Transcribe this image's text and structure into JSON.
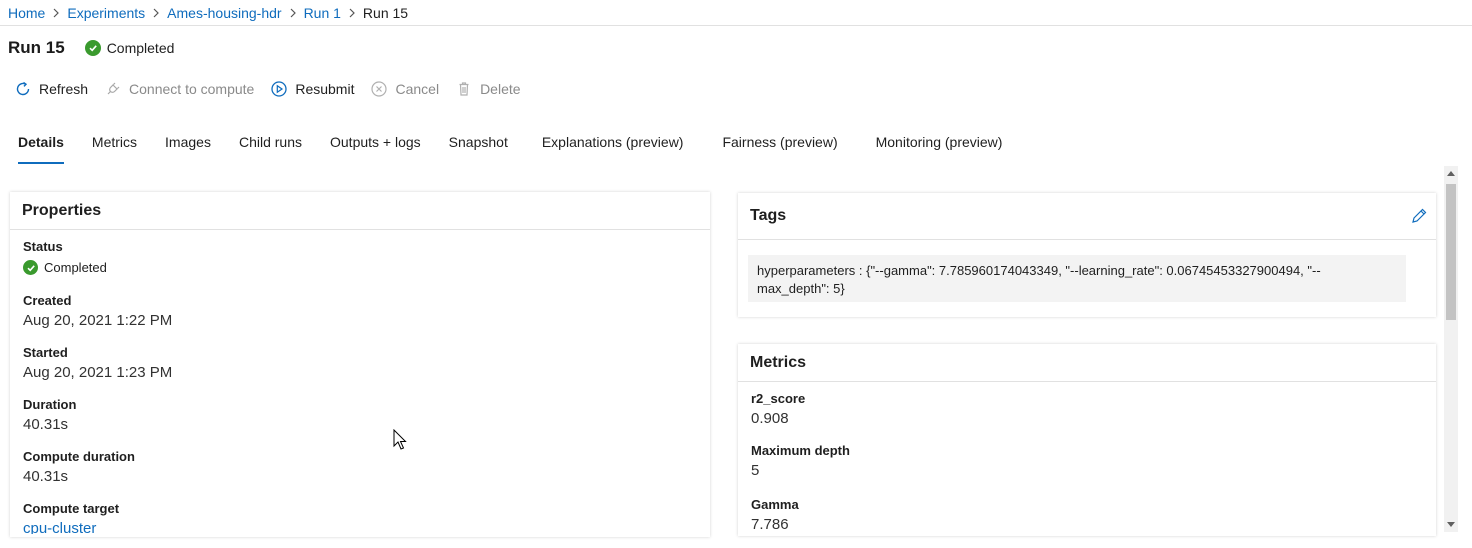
{
  "breadcrumb": {
    "items": [
      "Home",
      "Experiments",
      "Ames-housing-hdr",
      "Run 1"
    ],
    "current": "Run 15"
  },
  "header": {
    "title": "Run 15",
    "status": "Completed"
  },
  "toolbar": {
    "refresh": "Refresh",
    "connect": "Connect to compute",
    "resubmit": "Resubmit",
    "cancel": "Cancel",
    "delete": "Delete"
  },
  "tabs": [
    "Details",
    "Metrics",
    "Images",
    "Child runs",
    "Outputs + logs",
    "Snapshot",
    "Explanations (preview)",
    "Fairness (preview)",
    "Monitoring (preview)"
  ],
  "properties": {
    "title": "Properties",
    "status_label": "Status",
    "status_value": "Completed",
    "created_label": "Created",
    "created_value": "Aug 20, 2021 1:22 PM",
    "started_label": "Started",
    "started_value": "Aug 20, 2021 1:23 PM",
    "duration_label": "Duration",
    "duration_value": "40.31s",
    "compute_duration_label": "Compute duration",
    "compute_duration_value": "40.31s",
    "compute_target_label": "Compute target",
    "compute_target_value": "cpu-cluster"
  },
  "tags": {
    "title": "Tags",
    "text_line1": "hyperparameters : {\"--gamma\": 7.785960174043349, \"--learning_rate\": 0.06745453327900494, \"--",
    "text_line2": "max_depth\": 5}"
  },
  "metrics": {
    "title": "Metrics",
    "items": [
      {
        "label": "r2_score",
        "value": "0.908"
      },
      {
        "label": "Maximum depth",
        "value": "5"
      },
      {
        "label": "Gamma",
        "value": "7.786"
      }
    ]
  },
  "colors": {
    "link": "#0f6cbd",
    "success": "#3a9a2e",
    "disabled": "#8a8a8a"
  }
}
